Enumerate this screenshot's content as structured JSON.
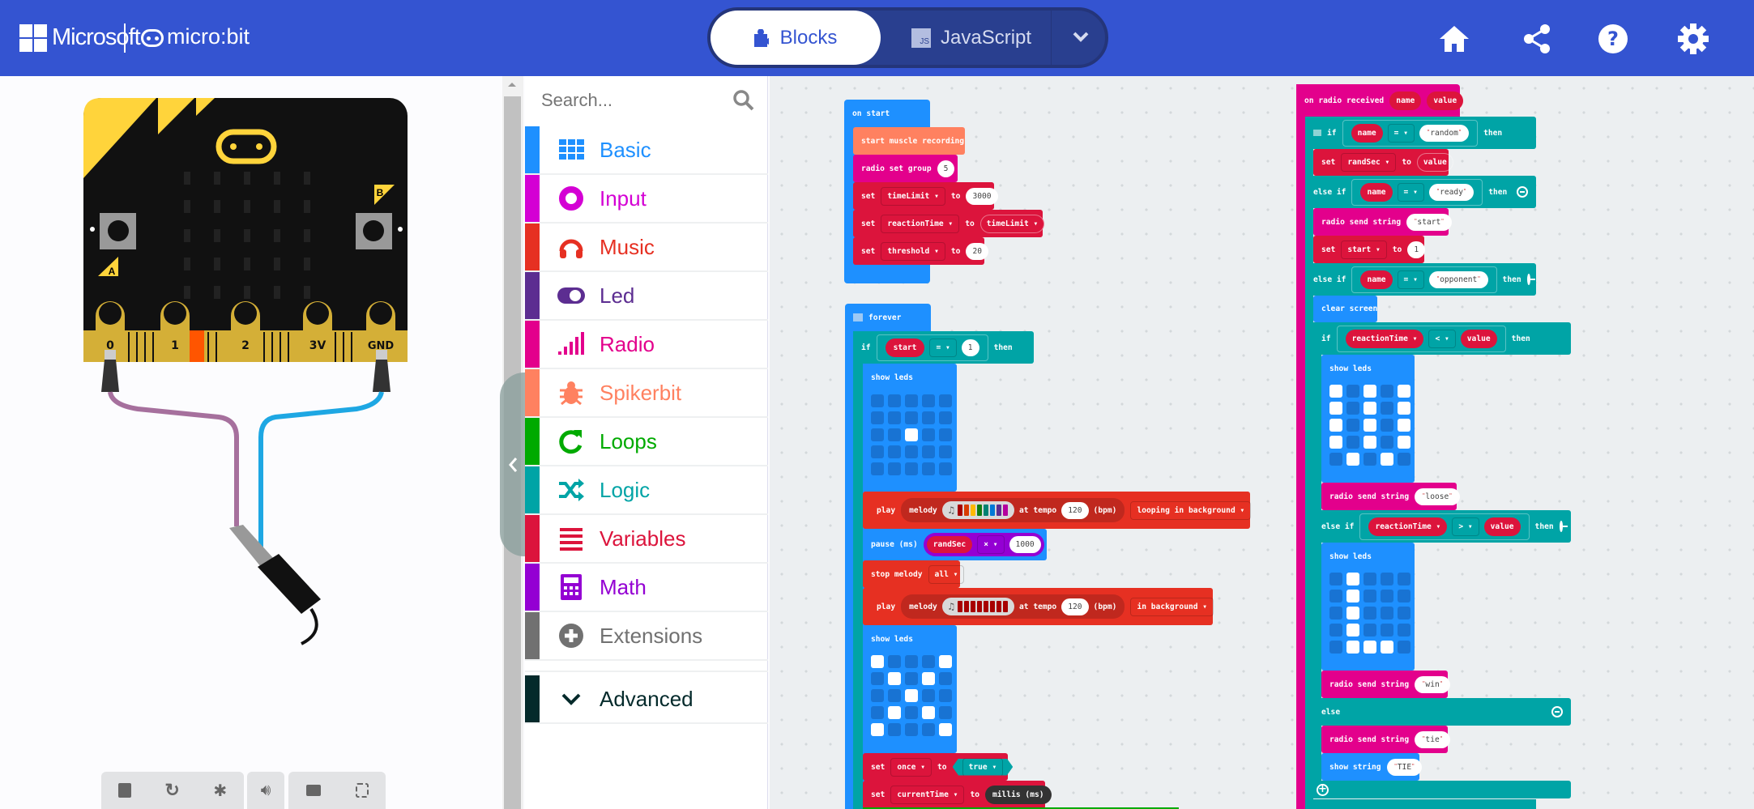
{
  "header": {
    "brand": "Microsoft",
    "product": "micro:bit",
    "tabs": [
      {
        "label": "Blocks",
        "active": true,
        "icon": "puzzle-icon"
      },
      {
        "label": "JavaScript",
        "active": false,
        "icon": "js-icon"
      }
    ],
    "icons": [
      "home-icon",
      "share-icon",
      "help-icon",
      "gear-icon"
    ],
    "color": "#3454D1"
  },
  "simulator": {
    "pins": [
      "0",
      "1",
      "2",
      "3V",
      "GND"
    ],
    "buttons": [
      "A",
      "B"
    ],
    "controls": [
      "stop-icon",
      "restart-icon",
      "debug-icon",
      "sound-icon",
      "screenshot-icon",
      "fullscreen-icon"
    ]
  },
  "toolbox": {
    "search_placeholder": "Search...",
    "categories": [
      {
        "label": "Basic",
        "color": "#1E90FF",
        "icon": "grid-icon"
      },
      {
        "label": "Input",
        "color": "#D400D4",
        "icon": "target-icon"
      },
      {
        "label": "Music",
        "color": "#E63022",
        "icon": "headphones-icon"
      },
      {
        "label": "Led",
        "color": "#5C2D91",
        "icon": "toggle-icon"
      },
      {
        "label": "Radio",
        "color": "#E3008C",
        "icon": "signal-icon"
      },
      {
        "label": "Spikerbit",
        "color": "#FF8160",
        "icon": "bug-icon"
      },
      {
        "label": "Loops",
        "color": "#00AA00",
        "icon": "loop-icon"
      },
      {
        "label": "Logic",
        "color": "#00A4A6",
        "icon": "shuffle-icon"
      },
      {
        "label": "Variables",
        "color": "#DC143C",
        "icon": "list-icon"
      },
      {
        "label": "Math",
        "color": "#9400D3",
        "icon": "calculator-icon"
      },
      {
        "label": "Extensions",
        "color": "#717171",
        "icon": "plus-circle-icon"
      }
    ],
    "advanced": {
      "label": "Advanced",
      "color": "#042A2B"
    }
  },
  "blocks": {
    "on_start": {
      "label": "on start",
      "muscle": "start muscle recording",
      "radio_group": {
        "label": "radio set group",
        "value": "5"
      },
      "set1": {
        "set": "set",
        "var": "timeLimit",
        "to": "to",
        "value": "3000"
      },
      "set2": {
        "set": "set",
        "var": "reactionTime",
        "to": "to",
        "value": "timeLimit"
      },
      "set3": {
        "set": "set",
        "var": "threshold",
        "to": "to",
        "value": "20"
      }
    },
    "forever": {
      "label": "forever",
      "if": {
        "if": "if",
        "var": "start",
        "op": "=",
        "value": "1",
        "then": "then"
      },
      "show_leds": "show leds",
      "play1": {
        "play": "play",
        "melody": "melody",
        "at": "at tempo",
        "tempo": "120",
        "bpm": "(bpm)",
        "mode": "looping in background"
      },
      "pause": {
        "label": "pause (ms)",
        "var": "randSec",
        "op": "×",
        "value": "1000"
      },
      "stop": {
        "label": "stop melody",
        "value": "all"
      },
      "play2": {
        "play": "play",
        "melody": "melody",
        "at": "at tempo",
        "tempo": "120",
        "bpm": "(bpm)",
        "mode": "in background"
      },
      "set_once": {
        "set": "set",
        "var": "once",
        "to": "to",
        "value": "true"
      },
      "set_time": {
        "set": "set",
        "var": "currentTime",
        "to": "to",
        "value": "millis (ms)"
      }
    },
    "radio": {
      "label": "on radio received",
      "p1": "name",
      "p2": "value",
      "if1": {
        "if": "if",
        "var": "name",
        "op": "=",
        "value": "random",
        "then": "then"
      },
      "set_rand": {
        "set": "set",
        "var": "randSec",
        "to": "to",
        "value": "value"
      },
      "elif1": {
        "label": "else if",
        "var": "name",
        "op": "=",
        "value": "ready",
        "then": "then"
      },
      "send_start": {
        "label": "radio send string",
        "value": "start"
      },
      "set_start": {
        "set": "set",
        "var": "start",
        "to": "to",
        "value": "1"
      },
      "elif2": {
        "label": "else if",
        "var": "name",
        "op": "=",
        "value": "opponent",
        "then": "then"
      },
      "clear": "clear screen",
      "if2": {
        "if": "if",
        "var": "reactionTime",
        "op": "<",
        "value": "value",
        "then": "then"
      },
      "show_leds": "show leds",
      "send_loose": {
        "label": "radio send string",
        "value": "loose"
      },
      "elif3": {
        "label": "else if",
        "var": "reactionTime",
        "op": ">",
        "value": "value",
        "then": "then"
      },
      "send_win": {
        "label": "radio send string",
        "value": "win"
      },
      "else": "else",
      "send_tie": {
        "label": "radio send string",
        "value": "tie"
      },
      "show_string": {
        "label": "show string",
        "value": "TIE"
      }
    },
    "leds": {
      "forever_1": [
        [
          0,
          0,
          0,
          0,
          0
        ],
        [
          0,
          0,
          0,
          0,
          0
        ],
        [
          0,
          0,
          1,
          0,
          0
        ],
        [
          0,
          0,
          0,
          0,
          0
        ],
        [
          0,
          0,
          0,
          0,
          0
        ]
      ],
      "forever_2": [
        [
          1,
          0,
          0,
          0,
          1
        ],
        [
          0,
          1,
          0,
          1,
          0
        ],
        [
          0,
          0,
          1,
          0,
          0
        ],
        [
          0,
          1,
          0,
          1,
          0
        ],
        [
          1,
          0,
          0,
          0,
          1
        ]
      ],
      "radio_lose": [
        [
          1,
          0,
          1,
          0,
          1
        ],
        [
          1,
          0,
          1,
          0,
          1
        ],
        [
          1,
          0,
          1,
          0,
          1
        ],
        [
          1,
          0,
          1,
          0,
          1
        ],
        [
          0,
          1,
          0,
          1,
          0
        ]
      ],
      "radio_win": [
        [
          0,
          1,
          0,
          0,
          0
        ],
        [
          0,
          1,
          0,
          0,
          0
        ],
        [
          0,
          1,
          0,
          0,
          0
        ],
        [
          0,
          1,
          0,
          0,
          0
        ],
        [
          0,
          1,
          1,
          1,
          0
        ]
      ]
    },
    "melody_colors": [
      "#A80000",
      "#D83B01",
      "#FFB900",
      "#107C10",
      "#008272",
      "#0078D7",
      "#5C2D91",
      "#B4009E"
    ],
    "melody2_colors": [
      "#A80000",
      "#A80000",
      "#A80000",
      "#A80000",
      "#A80000",
      "#A80000",
      "#A80000",
      "#A80000"
    ]
  }
}
